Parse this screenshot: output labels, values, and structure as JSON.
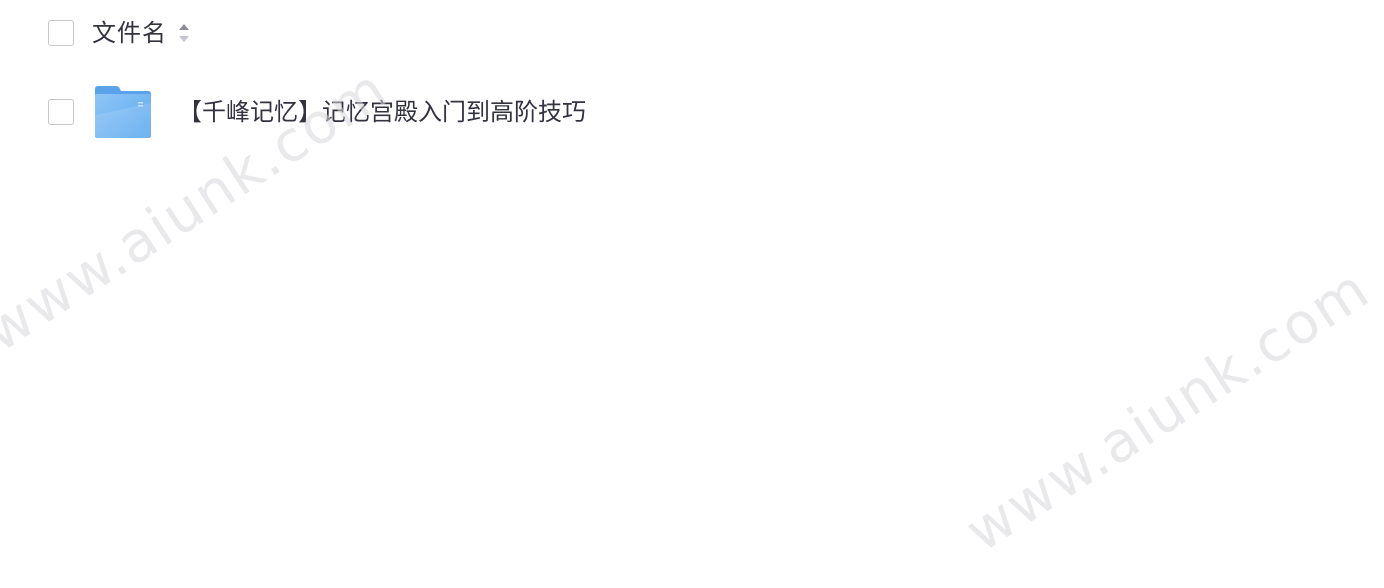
{
  "header": {
    "column_label": "文件名",
    "sort_icon": "sort-icon"
  },
  "files": [
    {
      "icon": "folder-icon",
      "name": "【千峰记忆】记忆宫殿入门到高阶技巧"
    }
  ],
  "watermark": {
    "text": "www.aiunk.com"
  },
  "colors": {
    "text": "#333340",
    "checkbox_border": "#c8c9cc",
    "folder_blue": "#6db3f2"
  }
}
